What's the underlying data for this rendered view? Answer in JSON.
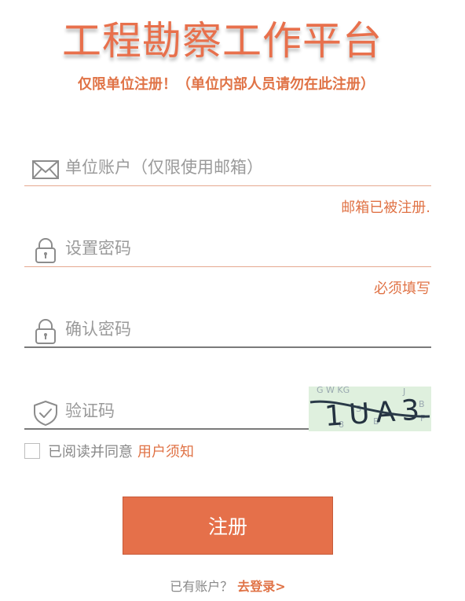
{
  "header": {
    "title": "工程勘察工作平台",
    "subtitle": "仅限单位注册！（单位内部人员请勿在此注册）"
  },
  "form": {
    "account": {
      "placeholder": "单位账户（仅限使用邮箱）",
      "icon": "envelope-icon",
      "error": "邮箱已被注册."
    },
    "password": {
      "placeholder": "设置密码",
      "icon": "lock-icon",
      "error": "必须填写"
    },
    "confirm_password": {
      "placeholder": "确认密码",
      "icon": "lock-icon"
    },
    "captcha": {
      "placeholder": "验证码",
      "icon": "shield-check-icon",
      "image_text": "1UA3"
    },
    "agreement": {
      "text": "已阅读并同意",
      "link": "用户须知"
    },
    "submit_label": "注册"
  },
  "footer": {
    "have_account": "已有账户？",
    "login_link": "去登录>"
  },
  "colors": {
    "accent": "#e5704a",
    "error_text": "#e07346",
    "underline_active": "#e6a890",
    "underline_default": "#7a7a7a"
  }
}
